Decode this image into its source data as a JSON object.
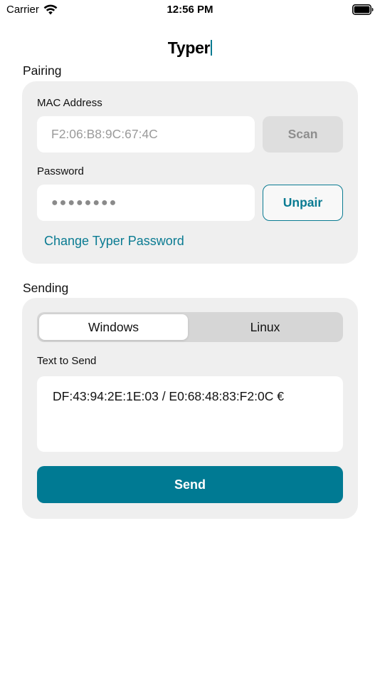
{
  "status_bar": {
    "carrier": "Carrier",
    "time": "12:56 PM",
    "icons": [
      "wifi-icon",
      "battery-icon"
    ]
  },
  "app": {
    "title": "Typer",
    "accent_color": "#0a7b92"
  },
  "pairing": {
    "heading": "Pairing",
    "mac_label": "MAC Address",
    "mac_placeholder": "F2:06:B8:9C:67:4C",
    "scan_label": "Scan",
    "password_label": "Password",
    "password_value": "●●●●●●●●",
    "unpair_label": "Unpair",
    "change_password_link": "Change Typer Password"
  },
  "sending": {
    "heading": "Sending",
    "os_options": [
      "Windows",
      "Linux"
    ],
    "os_selected": "Windows",
    "text_label": "Text to Send",
    "text_value": "DF:43:94:2E:1E:03 / E0:68:48:83:F2:0C €",
    "send_label": "Send",
    "send_color": "#007a93"
  }
}
